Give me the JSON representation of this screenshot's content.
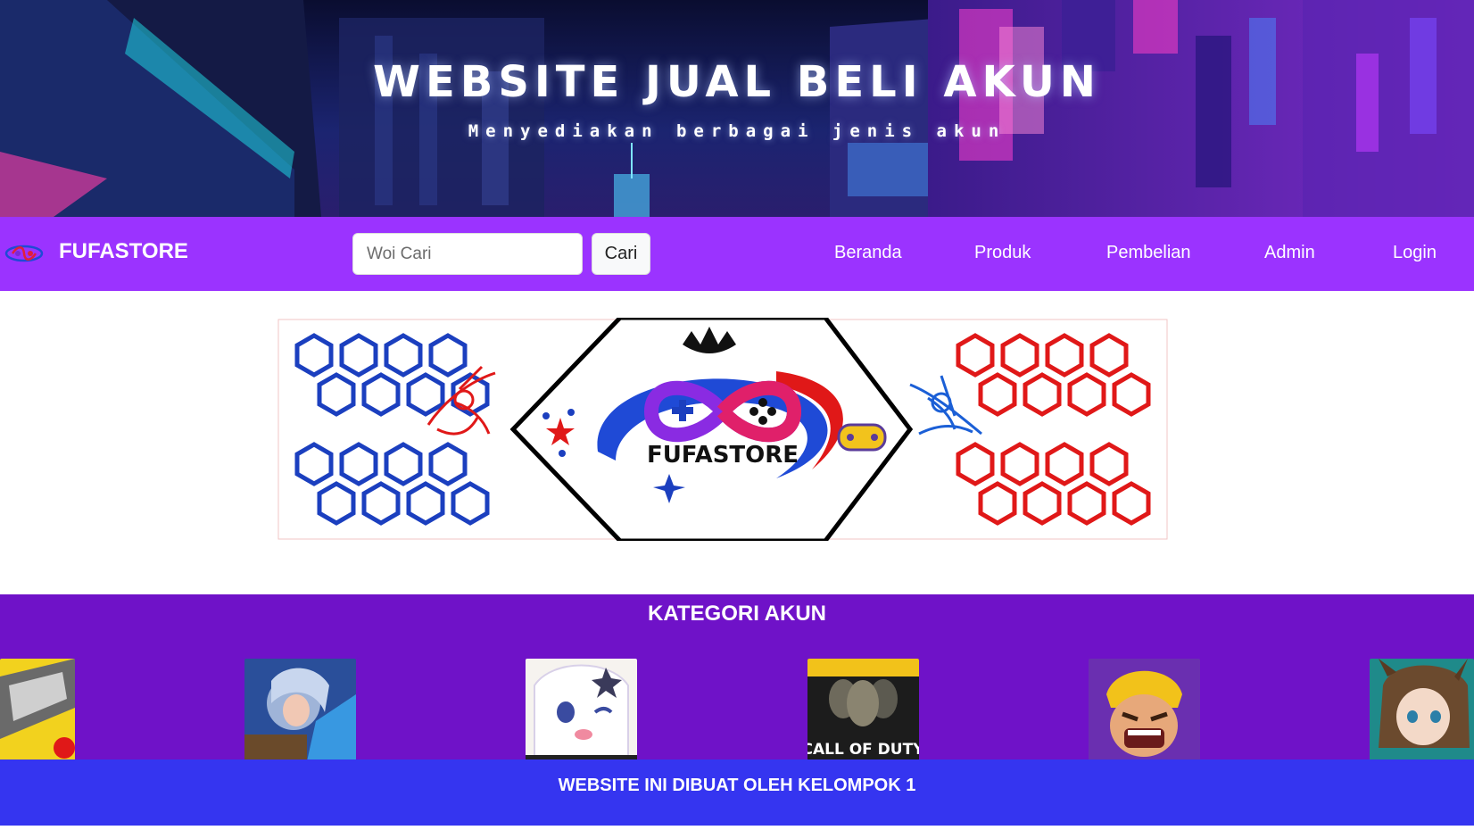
{
  "hero": {
    "title": "WEBSITE JUAL BELI AKUN",
    "subtitle": "Menyediakan berbagai jenis akun"
  },
  "navbar": {
    "brand": "FUFASTORE",
    "search_placeholder": "Woi Cari",
    "search_button": "Cari",
    "links": [
      "Beranda",
      "Produk",
      "Pembelian",
      "Admin",
      "Login"
    ]
  },
  "banner": {
    "logo_text": "FUFASTORE"
  },
  "category": {
    "title": "KATEGORI AKUN",
    "items": [
      {
        "icon": "free-fire-icon"
      },
      {
        "icon": "mobile-legends-icon"
      },
      {
        "icon": "genshin-impact-icon"
      },
      {
        "icon": "call-of-duty-icon",
        "text": "CALL OF DUTY"
      },
      {
        "icon": "clash-of-clans-icon"
      },
      {
        "icon": "arknights-icon"
      }
    ]
  },
  "footer": {
    "text": "WEBSITE INI DIBUAT OLEH KELOMPOK 1"
  },
  "colors": {
    "navbar": "#9b33ff",
    "category_bg": "#6f12c8",
    "footer_bg": "#3535f0"
  }
}
